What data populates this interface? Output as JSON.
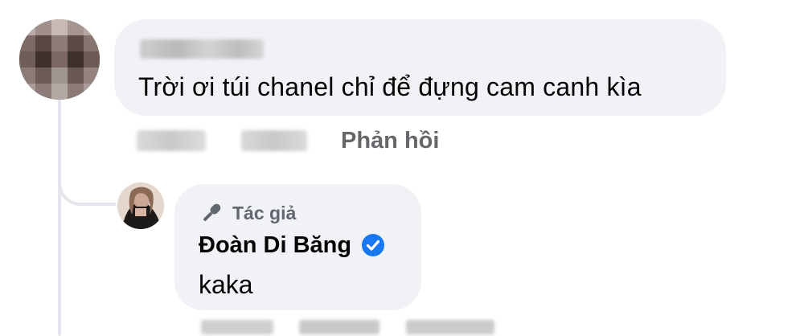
{
  "comment": {
    "author_name_blurred": true,
    "text": "Trời ơi túi chanel chỉ để đựng cam canh kìa",
    "actions": {
      "time_blurred": true,
      "like_blurred": true,
      "reply_label": "Phản hồi"
    }
  },
  "reply": {
    "badge_icon": "microphone-icon",
    "badge_label": "Tác giả",
    "author_name": "Đoàn Di Băng",
    "verified_icon": "verified-badge-icon",
    "verified_color": "#1877f2",
    "text": "kaka",
    "actions_blurred": true
  },
  "colors": {
    "bubble_bg": "#f0f2f5",
    "thread_line": "#e4e6eb",
    "secondary_text": "#65676b",
    "primary_text": "#050505"
  }
}
